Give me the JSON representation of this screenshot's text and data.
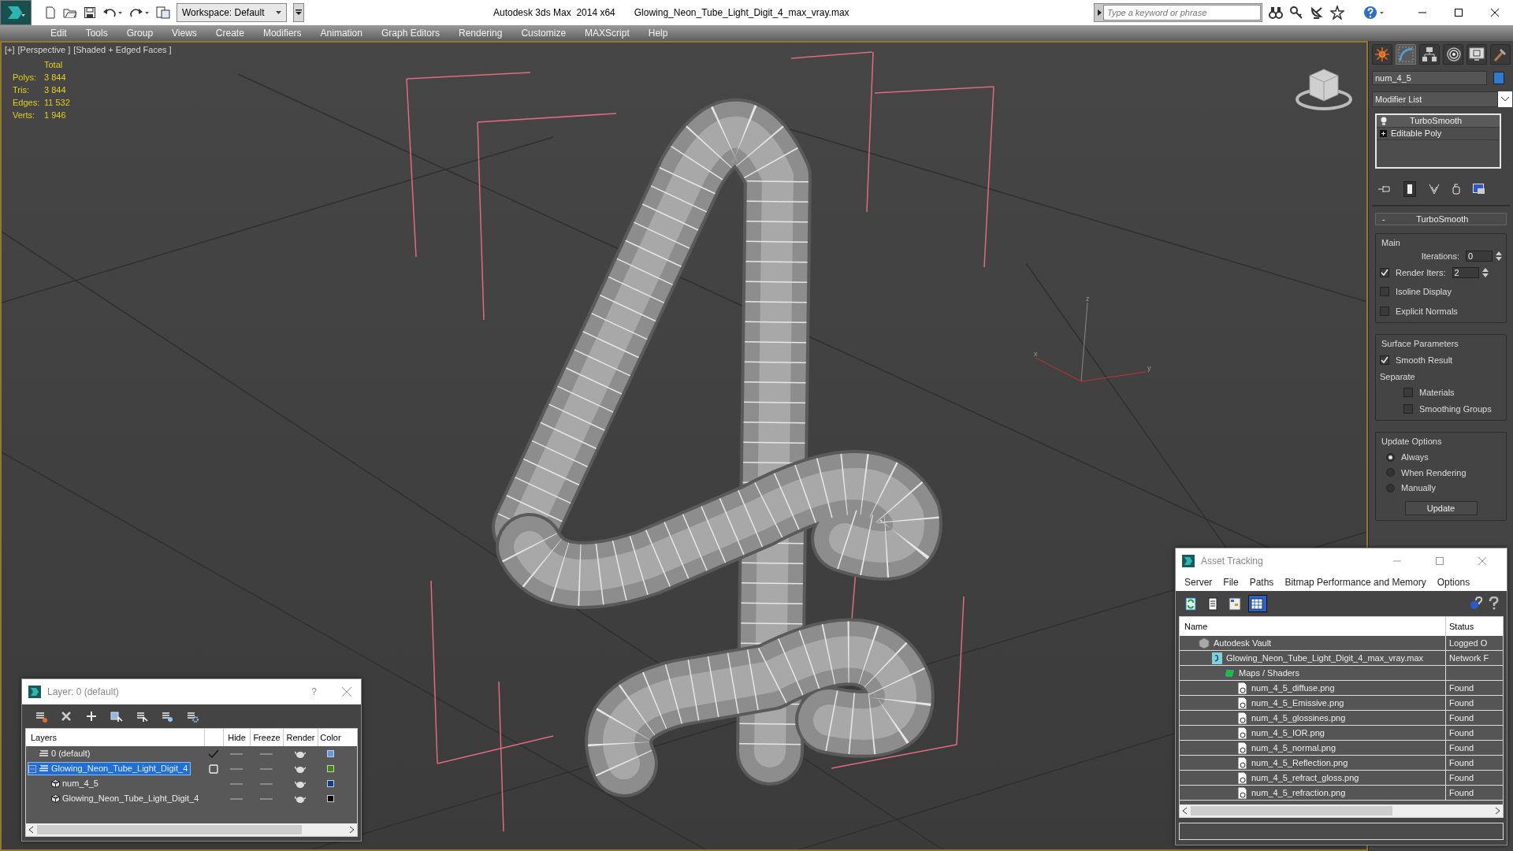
{
  "title_bar": {
    "workspace": "Workspace: Default",
    "app": "Autodesk 3ds Max  2014 x64",
    "file": "Glowing_Neon_Tube_Light_Digit_4_max_vray.max",
    "search": {
      "placeholder": "Type a keyword or phrase"
    }
  },
  "menu": [
    "Edit",
    "Tools",
    "Group",
    "Views",
    "Create",
    "Modifiers",
    "Animation",
    "Graph Editors",
    "Rendering",
    "Customize",
    "MAXScript",
    "Help"
  ],
  "viewport": {
    "labels": [
      "[+]",
      "[Perspective ]",
      "[Shaded + Edged Faces ]"
    ],
    "stats": {
      "header": "Total",
      "rows": [
        {
          "label": "Polys:",
          "value": "3 844"
        },
        {
          "label": "Tris:",
          "value": "3 844"
        },
        {
          "label": "Edges:",
          "value": "11 532"
        },
        {
          "label": "Verts:",
          "value": "1 946"
        }
      ]
    },
    "axis_labels": [
      "z",
      "x",
      "y"
    ]
  },
  "command_panel": {
    "tabs": [
      {
        "kind": "create",
        "selected": false
      },
      {
        "kind": "modify",
        "selected": true
      },
      {
        "kind": "hierarchy",
        "selected": false
      },
      {
        "kind": "motion",
        "selected": false
      },
      {
        "kind": "display",
        "selected": false
      },
      {
        "kind": "utilities",
        "selected": false
      }
    ],
    "object_name": "num_4_5",
    "modifier_list": "Modifier List",
    "stack": [
      {
        "name": "TurboSmooth",
        "kind": "modifier",
        "selected": true
      },
      {
        "name": "Editable Poly",
        "kind": "base",
        "selected": false
      }
    ],
    "rollout": {
      "title": "TurboSmooth",
      "collapse": "-",
      "main": {
        "legend": "Main",
        "iterations": {
          "label": "Iterations:",
          "value": "0"
        },
        "render_iters": {
          "label": "Render Iters:",
          "value": "2",
          "checked": true
        },
        "checks": [
          {
            "label": "Isoline Display",
            "checked": false
          },
          {
            "label": "Explicit Normals",
            "checked": false
          }
        ]
      },
      "surface": {
        "legend": "Surface Parameters",
        "smooth_result": {
          "label": "Smooth Result",
          "checked": true
        },
        "separate": "Separate",
        "separate_checks": [
          {
            "label": "Materials",
            "checked": false
          },
          {
            "label": "Smoothing Groups",
            "checked": false
          }
        ]
      },
      "update": {
        "legend": "Update Options",
        "options": [
          {
            "label": "Always",
            "selected": true
          },
          {
            "label": "When Rendering",
            "selected": false
          },
          {
            "label": "Manually",
            "selected": false
          }
        ],
        "button": "Update"
      }
    }
  },
  "layer_dialog": {
    "title": "Layer: 0 (default)",
    "help": "?",
    "columns": [
      "Layers",
      "Hide",
      "Freeze",
      "Render",
      "Color"
    ],
    "rows": [
      {
        "name": "0 (default)",
        "kind": "layer",
        "selected": false,
        "current": true,
        "color": "#5b9be8"
      },
      {
        "name": "Glowing_Neon_Tube_Light_Digit_4",
        "kind": "layer",
        "selected": true,
        "current": false,
        "expanded": true,
        "color": "#3a8a10",
        "children": [
          {
            "name": "num_4_5",
            "kind": "object",
            "selected": false,
            "color": "#0e3e8e"
          },
          {
            "name": "Glowing_Neon_Tube_Light_Digit_4",
            "kind": "object",
            "selected": false,
            "color": "#000000"
          }
        ]
      }
    ]
  },
  "asset_tracking": {
    "title": "Asset Tracking",
    "menu": [
      "Server",
      "File",
      "Paths",
      "Bitmap Performance and Memory",
      "Options"
    ],
    "view_buttons": [
      {
        "kind": "refresh",
        "selected": false
      },
      {
        "kind": "list",
        "selected": false
      },
      {
        "kind": "tree",
        "selected": false
      },
      {
        "kind": "table",
        "selected": true
      }
    ],
    "columns": [
      "Name",
      "Status"
    ],
    "rows": [
      {
        "name": "Autodesk Vault",
        "status": "Logged O",
        "kind": "vault",
        "children": [
          {
            "name": "Glowing_Neon_Tube_Light_Digit_4_max_vray.max",
            "status": "Network F",
            "kind": "max-file",
            "children": [
              {
                "name": "Maps / Shaders",
                "kind": "folder",
                "children": [
                  {
                    "name": "num_4_5_diffuse.png",
                    "status": "Found",
                    "kind": "bitmap"
                  },
                  {
                    "name": "num_4_5_Emissive.png",
                    "status": "Found",
                    "kind": "bitmap"
                  },
                  {
                    "name": "num_4_5_glossines.png",
                    "status": "Found",
                    "kind": "bitmap"
                  },
                  {
                    "name": "num_4_5_IOR.png",
                    "status": "Found",
                    "kind": "bitmap"
                  },
                  {
                    "name": "num_4_5_normal.png",
                    "status": "Found",
                    "kind": "bitmap"
                  },
                  {
                    "name": "num_4_5_Reflection.png",
                    "status": "Found",
                    "kind": "bitmap"
                  },
                  {
                    "name": "num_4_5_refract_gloss.png",
                    "status": "Found",
                    "kind": "bitmap"
                  },
                  {
                    "name": "num_4_5_refraction.png",
                    "status": "Found",
                    "kind": "bitmap"
                  }
                ]
              }
            ]
          }
        ]
      }
    ]
  }
}
